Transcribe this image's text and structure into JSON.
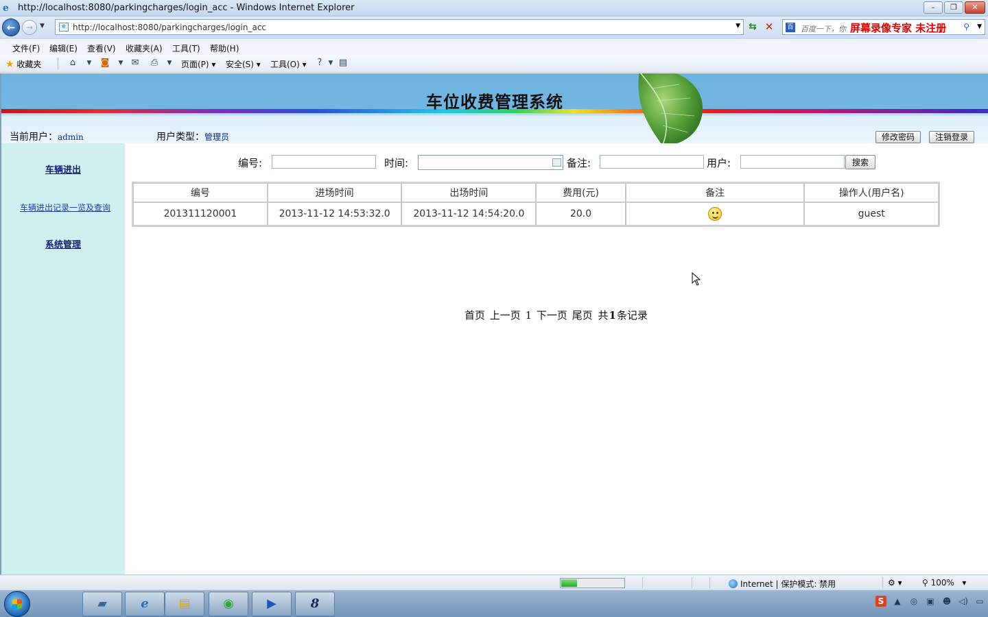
{
  "browser": {
    "window_title": "http://localhost:8080/parkingcharges/login_acc - Windows Internet Explorer",
    "url": "http://localhost:8080/parkingcharges/login_acc",
    "search_placeholder": "百度一下，你",
    "watermark": "屏幕录像专家  未注册",
    "menu": [
      "文件(F)",
      "编辑(E)",
      "查看(V)",
      "收藏夹(A)",
      "工具(T)",
      "帮助(H)"
    ],
    "favorites_label": "收藏夹",
    "commands": {
      "page": "页面(P)",
      "safety": "安全(S)",
      "tools": "工具(O)"
    },
    "status": {
      "zone": "Internet | 保护模式: 禁用",
      "zoom": "100%",
      "progress": 0.25
    }
  },
  "page": {
    "system_title": "车位收费管理系统",
    "current_user_label": "当前用户：",
    "current_user": "admin",
    "user_type_label": "用户类型：",
    "user_type": "管理员",
    "change_password_button": "修改密码",
    "logout_button": "注销登录",
    "sidebar": {
      "section_vehicle": "车辆进出",
      "link_records": "车辆进出记录一览及查询",
      "section_system": "系统管理"
    },
    "filters": {
      "id_label": "编号:",
      "time_label": "时间:",
      "remark_label": "备注:",
      "user_label": "用户:",
      "search_button": "搜索",
      "id_value": "",
      "time_value": "",
      "remark_value": "",
      "user_value": ""
    },
    "table": {
      "headers": [
        "编号",
        "进场时间",
        "出场时间",
        "费用(元)",
        "备注",
        "操作人(用户名)"
      ],
      "rows": [
        {
          "id": "201311120001",
          "entry_time": "2013-11-12 14:53:32.0",
          "exit_time": "2013-11-12 14:54:20.0",
          "fee": "20.0",
          "remark_icon": "smiley-icon",
          "operator": "guest"
        }
      ]
    },
    "pager": {
      "first": "首页",
      "prev": "上一页",
      "current": "1",
      "next": "下一页",
      "last": "尾页",
      "total_prefix": "共",
      "total_count": "1",
      "total_suffix": "条记录"
    }
  },
  "colors": {
    "banner": "#71b7e1",
    "sidebar": "#cef0ef",
    "link": "#1f3fb0"
  }
}
